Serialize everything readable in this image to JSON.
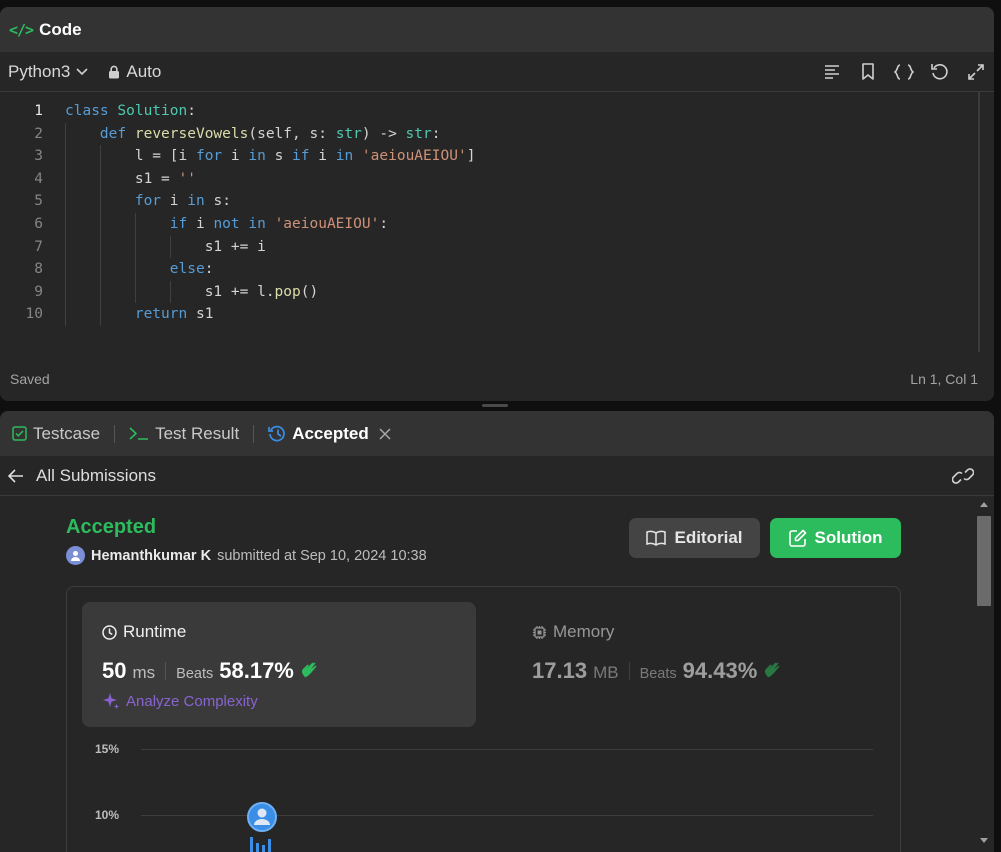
{
  "code_panel": {
    "title": "Code",
    "language": "Python3",
    "mode": "Auto",
    "status_left": "Saved",
    "status_right": "Ln 1, Col 1"
  },
  "code_lines": [
    "class Solution:",
    "    def reverseVowels(self, s: str) -> str:",
    "        l = [i for i in s if i in 'aeiouAEIOU']",
    "        s1 = ''",
    "        for i in s:",
    "            if i not in 'aeiouAEIOU':",
    "                s1 += i",
    "            else:",
    "                s1 += l.pop()",
    "        return s1"
  ],
  "result_panel": {
    "tabs": [
      {
        "label": "Testcase",
        "icon": "checkbox-icon"
      },
      {
        "label": "Test Result",
        "icon": "terminal-icon"
      },
      {
        "label": "Accepted",
        "icon": "history-icon"
      }
    ],
    "back_label": "All Submissions"
  },
  "submission": {
    "status": "Accepted",
    "user": "Hemanthkumar K",
    "submitted_text": "submitted at Sep 10, 2024 10:38",
    "editorial_label": "Editorial",
    "solution_label": "Solution"
  },
  "runtime": {
    "label": "Runtime",
    "value": "50",
    "unit": "ms",
    "beats_label": "Beats",
    "beats": "58.17%",
    "analyze_label": "Analyze Complexity"
  },
  "memory": {
    "label": "Memory",
    "value": "17.13",
    "unit": "MB",
    "beats_label": "Beats",
    "beats": "94.43%"
  },
  "chart_ticks": [
    "15%",
    "10%"
  ],
  "colors": {
    "accent_green": "#2cbb5d",
    "accent_blue": "#3a8ee6",
    "accent_purple": "#8a63d2"
  }
}
